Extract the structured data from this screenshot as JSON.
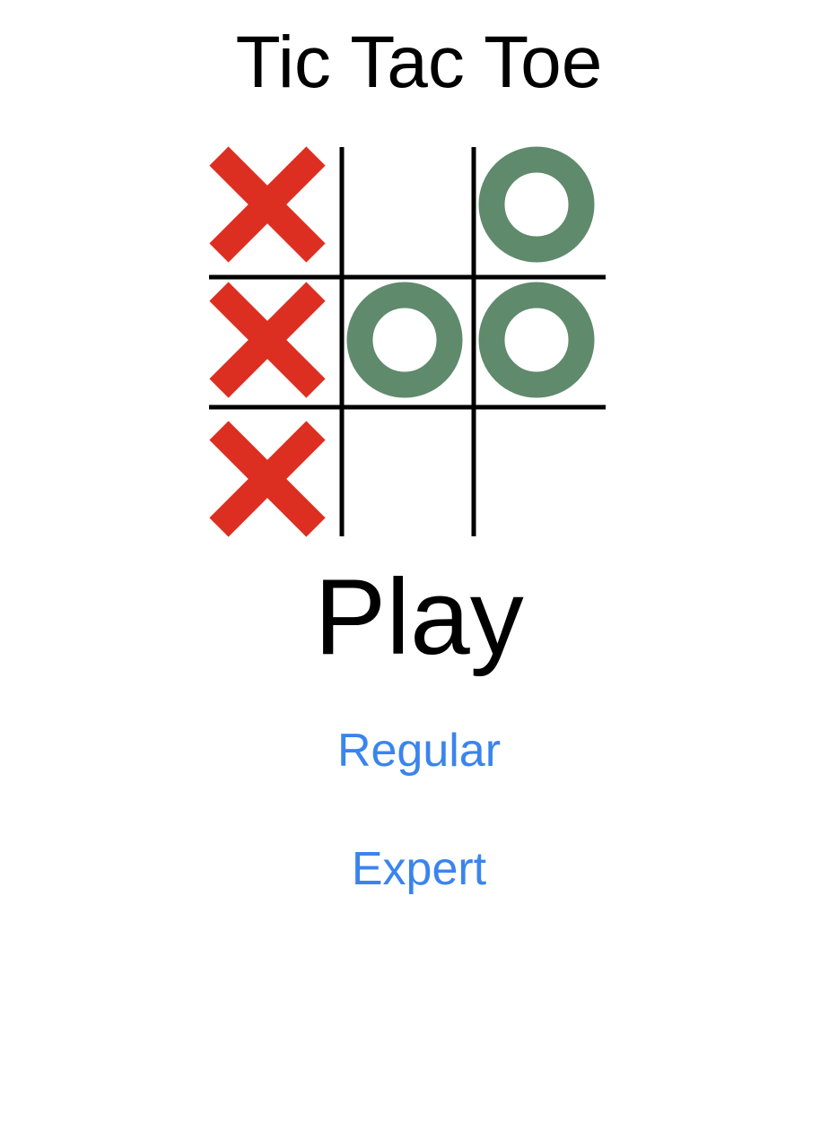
{
  "title": "Tic Tac Toe",
  "play_heading": "Play",
  "buttons": {
    "regular_label": "Regular",
    "expert_label": "Expert"
  },
  "colors": {
    "x_mark": "#dc2f21",
    "o_mark": "#5f8a6c",
    "grid_line": "#000000",
    "link": "#3a84ee",
    "text": "#000000"
  },
  "board": {
    "cells": [
      [
        "X",
        "",
        "O"
      ],
      [
        "X",
        "O",
        "O"
      ],
      [
        "X",
        "",
        ""
      ]
    ]
  }
}
